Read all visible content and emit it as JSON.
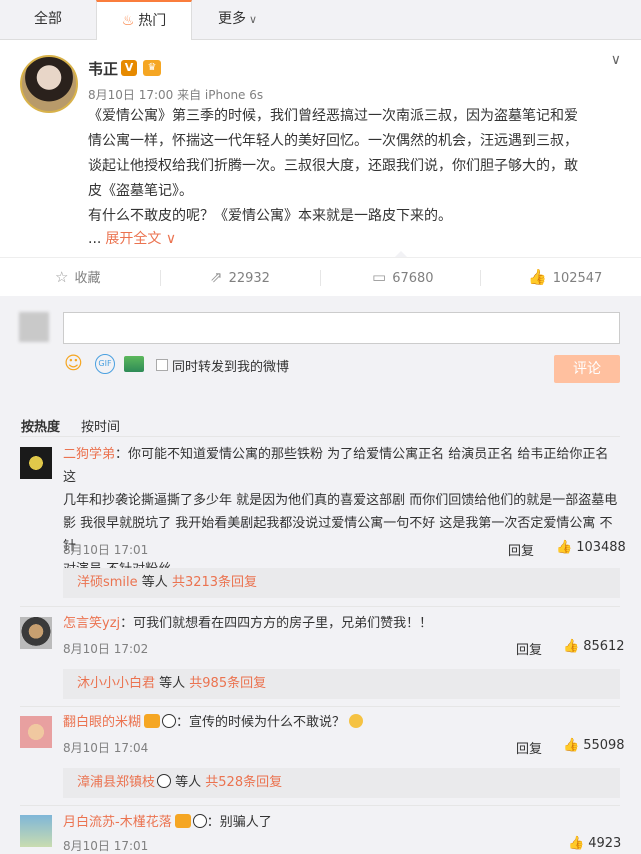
{
  "tabs": {
    "all": "全部",
    "hot": "热门",
    "more": "更多"
  },
  "post": {
    "author": "韦正",
    "verified_mark": "V",
    "meta": "8月10日 17:00 来自 iPhone 6s",
    "lines": [
      "《爱情公寓》第三季的时候，我们曾经恶搞过一次南派三叔，因为盗墓笔记和爱",
      "情公寓一样，怀揣这一代年轻人的美好回忆。一次偶然的机会，汪远遇到三叔，",
      "谈起让他授权给我们折腾一次。三叔很大度，还跟我们说，你们胆子够大的，敢",
      "皮《盗墓笔记》。",
      "有什么不敢皮的呢？《爱情公寓》本来就是一路皮下来的。"
    ],
    "expand": "展开全文",
    "actions": {
      "fav": "收藏",
      "forward": "22932",
      "comment": "67680",
      "like": "102547"
    }
  },
  "composer": {
    "sync_label": "同时转发到我的微博",
    "submit": "评论",
    "gif": "GIF"
  },
  "sort": {
    "heat": "按热度",
    "time": "按时间"
  },
  "comments": [
    {
      "name": "二狗学弟",
      "lines": [
        "：你可能不知道爱情公寓的那些铁粉 为了给爱情公寓正名 给演员正名 给韦正给你正名 这",
        "几年和抄袭论撕逼撕了多少年 就是因为他们真的喜爱这部剧 而你们回馈给他们的就是一部盗墓电",
        "影 我很早就脱坑了 我开始看美剧起我都没说过爱情公寓一句不好 这是我第一次否定爱情公寓 不针",
        "对演员 不针对粉丝..."
      ],
      "time": "8月10日 17:01",
      "reply": "回复",
      "likes": "103488",
      "sub_name": "洋硕smile",
      "sub_mid": " 等人 ",
      "sub_count": "共3213条回复"
    },
    {
      "name": "怎言笑yzj",
      "text": "：可我们就想看在四四方方的房子里，兄弟们赞我！！",
      "time": "8月10日 17:02",
      "reply": "回复",
      "likes": "85612",
      "sub_name": "沐小小小白君",
      "sub_mid": " 等人 ",
      "sub_count": "共985条回复"
    },
    {
      "name": "翻白眼的米糊",
      "text": "：宣传的时候为什么不敢说？",
      "time": "8月10日 17:04",
      "reply": "回复",
      "likes": "55098",
      "sub_name": "漳浦县郑镇枝",
      "sub_mid": " 等人 ",
      "sub_count": "共528条回复"
    },
    {
      "name": "月白流苏-木槿花落",
      "text": "：别骗人了",
      "time": "8月10日 17:01",
      "likes": "4923"
    }
  ]
}
